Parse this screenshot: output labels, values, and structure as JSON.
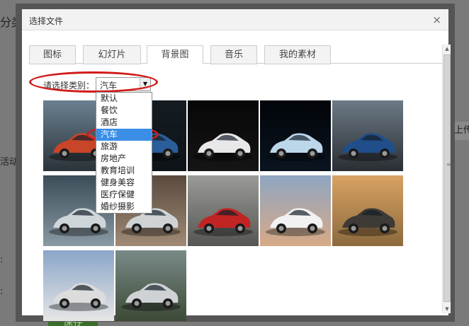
{
  "background": {
    "title_fragment": "分类",
    "side_text_1": "活动",
    "side_text_2": ":",
    "side_text_3": ":",
    "upload_label": "上传",
    "save_label": "保存"
  },
  "dialog": {
    "title": "选择文件",
    "close_glyph": "×",
    "tabs": [
      {
        "label": "图标"
      },
      {
        "label": "幻灯片"
      },
      {
        "label": "背景图"
      },
      {
        "label": "音乐"
      },
      {
        "label": "我的素材"
      }
    ],
    "active_tab": "背景图",
    "filter": {
      "label": "请选择类别：",
      "selected": "汽车",
      "arrow_glyph": "▼"
    },
    "category_options": [
      {
        "label": "默认"
      },
      {
        "label": "餐饮"
      },
      {
        "label": "酒店"
      },
      {
        "label": "汽车"
      },
      {
        "label": "旅游"
      },
      {
        "label": "房地产"
      },
      {
        "label": "教育培训"
      },
      {
        "label": "健身美容"
      },
      {
        "label": "医疗保健"
      },
      {
        "label": "婚纱摄影"
      }
    ],
    "scroll": {
      "up_glyph": "▲",
      "down_glyph": "▼",
      "grip_glyph": "≡"
    }
  },
  "images": [
    {
      "name": "car-orange-bmw",
      "colors": [
        "#6a8090",
        "#2b3338",
        "#c8452a"
      ]
    },
    {
      "name": "car-blue-bmw-z4",
      "colors": [
        "#141c22",
        "#0e1318",
        "#2a5d9a"
      ]
    },
    {
      "name": "car-white-porsche-dark",
      "colors": [
        "#070707",
        "#151515",
        "#e8e8e8"
      ]
    },
    {
      "name": "car-silver-neon",
      "colors": [
        "#020509",
        "#0a1420",
        "#bcd6ea"
      ]
    },
    {
      "name": "car-blue-bmw-m6",
      "colors": [
        "#6c7a86",
        "#2a2e33",
        "#1f4e8a"
      ]
    },
    {
      "name": "car-silver-storm",
      "colors": [
        "#3c4c58",
        "#8a9aa4",
        "#cfd6da"
      ]
    },
    {
      "name": "car-silver-sunset",
      "colors": [
        "#5a4a3e",
        "#a08a76",
        "#cfd3d6"
      ]
    },
    {
      "name": "car-red-highway",
      "colors": [
        "#9a9a96",
        "#555552",
        "#c22424"
      ]
    },
    {
      "name": "car-white-lake",
      "colors": [
        "#8fa6c2",
        "#d7a986",
        "#f2f2f2"
      ]
    },
    {
      "name": "car-dark-desert",
      "colors": [
        "#d8a262",
        "#8b6a3e",
        "#3e3a36"
      ]
    },
    {
      "name": "car-white-carrera",
      "colors": [
        "#8aa6c8",
        "#e6e6e6",
        "#dcdcdc"
      ]
    },
    {
      "name": "car-silver-mountain",
      "colors": [
        "#7a8a88",
        "#3c4a36",
        "#cfd2d4"
      ]
    }
  ]
}
